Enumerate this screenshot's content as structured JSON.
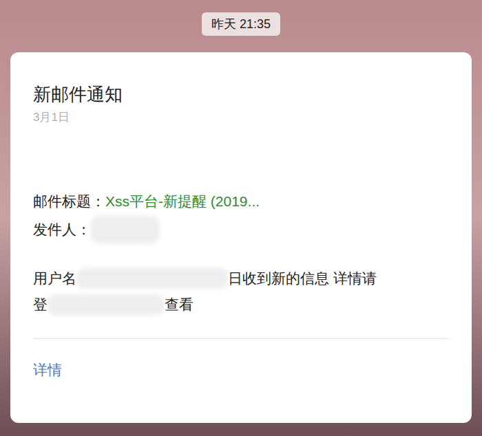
{
  "timestamp": "昨天 21:35",
  "card": {
    "title": "新邮件通知",
    "date": "3月1日",
    "subject": {
      "label": "邮件标题：",
      "value": "Xss平台-新提醒 (2019..."
    },
    "sender": {
      "label": "发件人："
    },
    "message_lines": [
      {
        "before": "用户名",
        "after": "日收到新的信息 详情请"
      },
      {
        "before": "登",
        "after": "查看"
      }
    ],
    "link": "详情"
  }
}
